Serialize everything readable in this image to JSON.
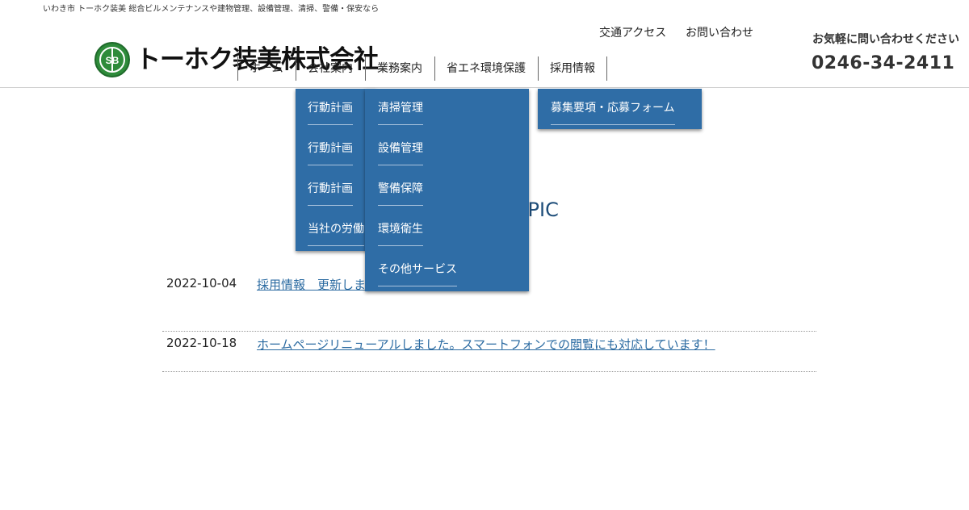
{
  "header": {
    "tagline": "いわき市 トーホク装美 総合ビルメンテナンスや建物管理、設備管理、清掃、警備・保安なら",
    "logo_text": "トーホク装美株式会社",
    "logo_mark_text": "SB",
    "utility_links": [
      "交通アクセス",
      "お問い合わせ"
    ],
    "cta_label": "お気軽に問い合わせください",
    "phone": "0246-34-2411"
  },
  "nav": {
    "items": [
      "ホーム",
      "会社案内",
      "業務案内",
      "省エネ環境保護",
      "採用情報"
    ]
  },
  "dropdowns": {
    "company": [
      "行動計画",
      "行動計画",
      "行動計画",
      "当社の労働"
    ],
    "services": [
      "清掃管理",
      "設備管理",
      "警備保障",
      "環境衛生",
      "その他サービス"
    ],
    "recruit": [
      "募集要項・応募フォーム"
    ]
  },
  "topics": {
    "heading": "TOPIC",
    "items": [
      {
        "date": "2022-10-04",
        "title": "採用情報　更新しました。"
      },
      {
        "date": "2022-10-18",
        "title": "ホームページリニューアルしました。スマートフォンでの閲覧にも対応しています！"
      }
    ]
  },
  "colors": {
    "dropdown_bg": "#2f6da6",
    "link": "#2a6aa1",
    "logo_green": "#2e8b3a"
  }
}
